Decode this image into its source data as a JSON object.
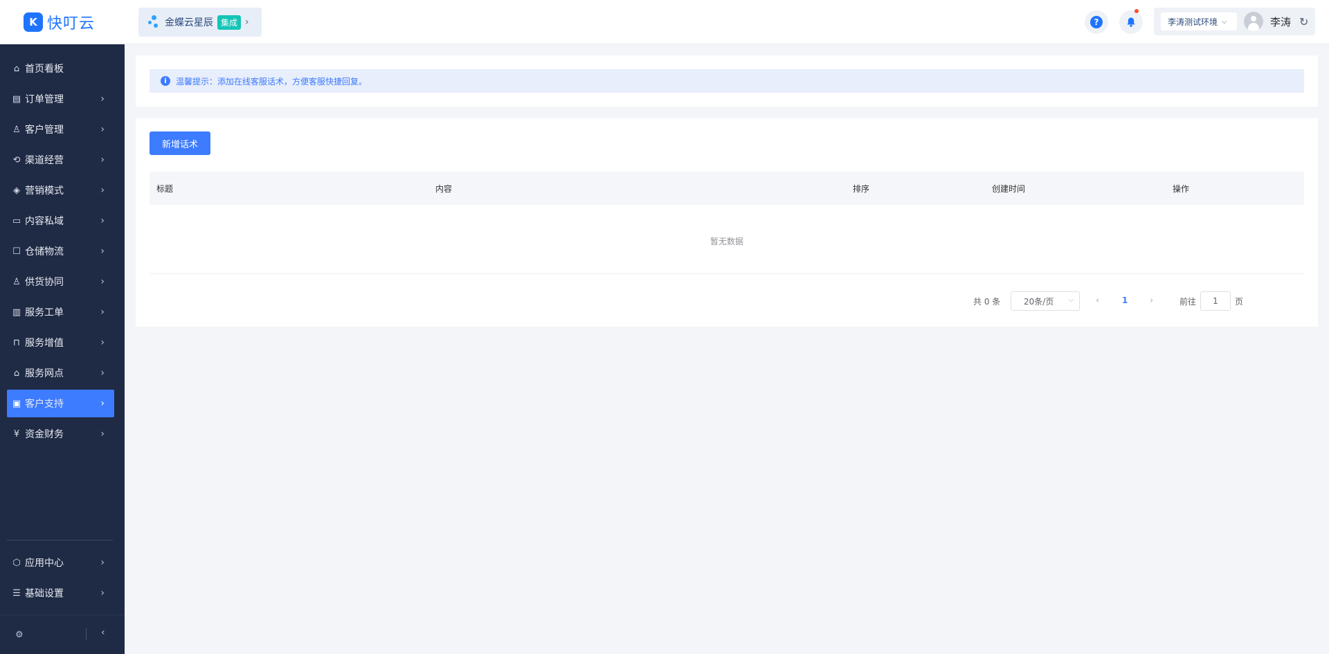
{
  "app": {
    "logo_text": "快叮云",
    "logo_mark": "K"
  },
  "integration": {
    "label": "金蝶云星辰",
    "badge": "集成"
  },
  "header": {
    "env": "李涛测试环境",
    "user_name": "李涛"
  },
  "sidebar": {
    "items": [
      {
        "label": "首页看板",
        "icon": "home-icon"
      },
      {
        "label": "订单管理",
        "icon": "clipboard-icon"
      },
      {
        "label": "客户管理",
        "icon": "user-icon"
      },
      {
        "label": "渠道经营",
        "icon": "channel-icon"
      },
      {
        "label": "营销模式",
        "icon": "tag-icon"
      },
      {
        "label": "内容私域",
        "icon": "image-icon"
      },
      {
        "label": "仓储物流",
        "icon": "box-icon"
      },
      {
        "label": "供货协同",
        "icon": "supply-icon"
      },
      {
        "label": "服务工单",
        "icon": "ticket-icon"
      },
      {
        "label": "服务增值",
        "icon": "bag-icon"
      },
      {
        "label": "服务网点",
        "icon": "store-icon"
      },
      {
        "label": "客户支持",
        "icon": "support-icon",
        "active": true
      },
      {
        "label": "资金财务",
        "icon": "yen-icon"
      },
      {
        "label": "应用中心",
        "icon": "cube-icon"
      },
      {
        "label": "基础设置",
        "icon": "sliders-icon"
      }
    ]
  },
  "tip": {
    "text": "温馨提示：添加在线客服话术，方便客服快捷回复。"
  },
  "main": {
    "add_button": "新增话术",
    "columns": [
      "标题",
      "内容",
      "排序",
      "创建时间",
      "操作"
    ],
    "empty_text": "暂无数据"
  },
  "pagination": {
    "total_text": "共 0 条",
    "page_size": "20条/页",
    "current_page": "1",
    "goto_label": "前往",
    "goto_value": "1",
    "goto_suffix": "页"
  },
  "colors": {
    "primary": "#3d7bff",
    "sidebar_bg": "#1f2a44",
    "logo": "#1f74ff"
  }
}
